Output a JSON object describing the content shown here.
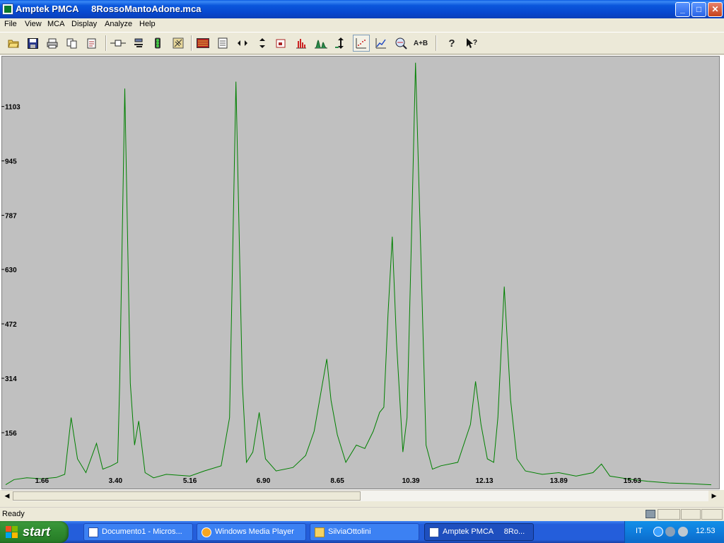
{
  "window": {
    "title": "Amptek PMCA     8RossoMantoAdone.mca",
    "controls": {
      "minimize": "_",
      "maximize": "□",
      "close": "✕"
    }
  },
  "menu": [
    "File",
    "View",
    "MCA",
    "Display",
    "Analyze",
    "Help"
  ],
  "toolbar": {
    "icons": [
      "open-icon",
      "save-icon",
      "print-icon",
      "copy-icon",
      "report-icon",
      "roi-marker-icon",
      "clear-roi-icon",
      "traffic-light-icon",
      "calibrate-icon",
      "spectrum-display-icon",
      "properties-icon",
      "expand-horizontal-icon",
      "expand-vertical-icon",
      "zoom-box-icon",
      "histogram-icon",
      "peaks-icon",
      "auto-scale-icon",
      "points-mode-icon",
      "line-mode-icon",
      "zoom-search-icon",
      "compare-spectra-icon",
      "help-icon",
      "context-help-icon"
    ],
    "compare_label": "A+B",
    "pressed": "points-mode-icon"
  },
  "status": {
    "text": "Ready"
  },
  "chart_data": {
    "type": "line",
    "title": "",
    "xlabel": "",
    "ylabel": "",
    "x_ticks": [
      "1.66",
      "3.40",
      "5.16",
      "6.90",
      "8.65",
      "10.39",
      "12.13",
      "13.89",
      "15.63"
    ],
    "y_ticks": [
      "156",
      "314",
      "472",
      "630",
      "787",
      "945",
      "1103"
    ],
    "xlim": [
      0.7,
      17.7
    ],
    "ylim": [
      0,
      1250
    ],
    "grid": false,
    "line_color": "#008000",
    "background": "#c0c0c0",
    "series": [
      {
        "values_xy": [
          [
            0.8,
            5
          ],
          [
            1.0,
            20
          ],
          [
            1.3,
            25
          ],
          [
            1.66,
            22
          ],
          [
            2.0,
            26
          ],
          [
            2.2,
            35
          ],
          [
            2.35,
            200
          ],
          [
            2.5,
            80
          ],
          [
            2.7,
            40
          ],
          [
            2.95,
            125
          ],
          [
            3.1,
            50
          ],
          [
            3.3,
            60
          ],
          [
            3.45,
            70
          ],
          [
            3.5,
            300
          ],
          [
            3.62,
            1155
          ],
          [
            3.75,
            300
          ],
          [
            3.85,
            120
          ],
          [
            3.95,
            190
          ],
          [
            4.1,
            40
          ],
          [
            4.3,
            25
          ],
          [
            4.6,
            35
          ],
          [
            5.16,
            30
          ],
          [
            5.5,
            45
          ],
          [
            5.9,
            60
          ],
          [
            6.1,
            200
          ],
          [
            6.25,
            1175
          ],
          [
            6.4,
            300
          ],
          [
            6.5,
            70
          ],
          [
            6.65,
            100
          ],
          [
            6.8,
            215
          ],
          [
            6.95,
            80
          ],
          [
            7.2,
            45
          ],
          [
            7.6,
            55
          ],
          [
            7.9,
            90
          ],
          [
            8.1,
            160
          ],
          [
            8.3,
            300
          ],
          [
            8.4,
            370
          ],
          [
            8.5,
            250
          ],
          [
            8.65,
            150
          ],
          [
            8.85,
            70
          ],
          [
            9.1,
            120
          ],
          [
            9.3,
            110
          ],
          [
            9.5,
            160
          ],
          [
            9.65,
            215
          ],
          [
            9.75,
            230
          ],
          [
            9.85,
            500
          ],
          [
            9.95,
            725
          ],
          [
            10.05,
            420
          ],
          [
            10.2,
            100
          ],
          [
            10.3,
            200
          ],
          [
            10.4,
            700
          ],
          [
            10.5,
            1230
          ],
          [
            10.62,
            700
          ],
          [
            10.75,
            120
          ],
          [
            10.9,
            50
          ],
          [
            11.1,
            60
          ],
          [
            11.5,
            70
          ],
          [
            11.8,
            180
          ],
          [
            11.92,
            305
          ],
          [
            12.05,
            180
          ],
          [
            12.2,
            80
          ],
          [
            12.35,
            70
          ],
          [
            12.45,
            200
          ],
          [
            12.6,
            580
          ],
          [
            12.75,
            250
          ],
          [
            12.9,
            80
          ],
          [
            13.1,
            45
          ],
          [
            13.5,
            35
          ],
          [
            13.89,
            40
          ],
          [
            14.3,
            30
          ],
          [
            14.7,
            40
          ],
          [
            14.9,
            65
          ],
          [
            15.1,
            30
          ],
          [
            15.63,
            20
          ],
          [
            16.0,
            15
          ],
          [
            16.5,
            10
          ],
          [
            17.0,
            8
          ],
          [
            17.5,
            5
          ]
        ]
      }
    ]
  },
  "taskbar": {
    "start_label": "start",
    "tasks": [
      {
        "label": "Documento1 - Micros...",
        "icon": "word-icon"
      },
      {
        "label": "Windows Media Player",
        "icon": "media-player-icon"
      },
      {
        "label": "SilviaOttolini",
        "icon": "folder-icon"
      },
      {
        "label": "Amptek PMCA     8Ro...",
        "icon": "pmca-icon"
      }
    ],
    "tray": {
      "language": "IT",
      "clock": "12.53"
    }
  }
}
